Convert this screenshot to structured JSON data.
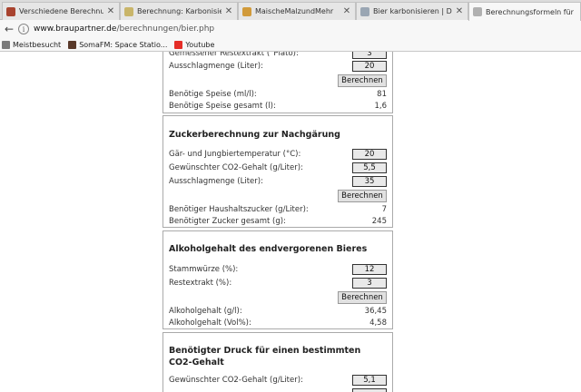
{
  "tabs": [
    {
      "title": "Verschiedene Berechnung...",
      "favicon_color": "#a8432f"
    },
    {
      "title": "Berechnung: Karbonisieru...",
      "favicon_color": "#c9b56a"
    },
    {
      "title": "MaischeMalzundMehr",
      "favicon_color": "#d19a3a"
    },
    {
      "title": "Bier karbonisieren | Der Bier-Br...",
      "favicon_color": "#9aa6b3"
    },
    {
      "title": "Berechnungsformeln für Hausb...",
      "favicon_color": "#b0b0b0"
    }
  ],
  "address": {
    "host": "www.braupartner.de",
    "path": "/berechnungen/bier.php"
  },
  "bookmarks": [
    {
      "label": "Meistbesucht",
      "icon_color": "#7a7a7a"
    },
    {
      "label": "SomaFM: Space Statio...",
      "icon_color": "#5a3a2a"
    },
    {
      "label": "Youtube",
      "icon_color": "#e52d27"
    }
  ],
  "panel1": {
    "row1_label": "Gemessener Restextrakt (°Plato):",
    "row1_value": "3",
    "row2_label": "Ausschlagmenge (Liter):",
    "row2_value": "20",
    "button": "Berechnen",
    "res1_label": "Benötige Speise (ml/l):",
    "res1_value": "81",
    "res2_label": "Benötige Speise gesamt (l):",
    "res2_value": "1,6"
  },
  "panel2": {
    "title": "Zuckerberechnung zur Nachgärung",
    "row1_label": "Gär- und Jungbiertemperatur (°C):",
    "row1_value": "20",
    "row2_label": "Gewünschter CO2-Gehalt (g/Liter):",
    "row2_value": "5,5",
    "row3_label": "Ausschlagmenge (Liter):",
    "row3_value": "35",
    "button": "Berechnen",
    "res1_label": "Benötiger Haushaltszucker (g/Liter):",
    "res1_value": "7",
    "res2_label": "Benötigter Zucker gesamt (g):",
    "res2_value": "245"
  },
  "panel3": {
    "title": "Alkoholgehalt des endvergorenen Bieres",
    "row1_label": "Stammwürze (%):",
    "row1_value": "12",
    "row2_label": "Restextrakt (%):",
    "row2_value": "3",
    "button": "Berechnen",
    "res1_label": "Alkoholgehalt (g/l):",
    "res1_value": "36,45",
    "res2_label": "Alkoholgehalt (Vol%):",
    "res2_value": "4,58"
  },
  "panel4": {
    "title_line1": "Benötigter Druck für einen bestimmten",
    "title_line2": "CO2-Gehalt",
    "row1_label": "Gewünschter CO2-Gehalt (g/Liter):",
    "row1_value": "5,1"
  }
}
